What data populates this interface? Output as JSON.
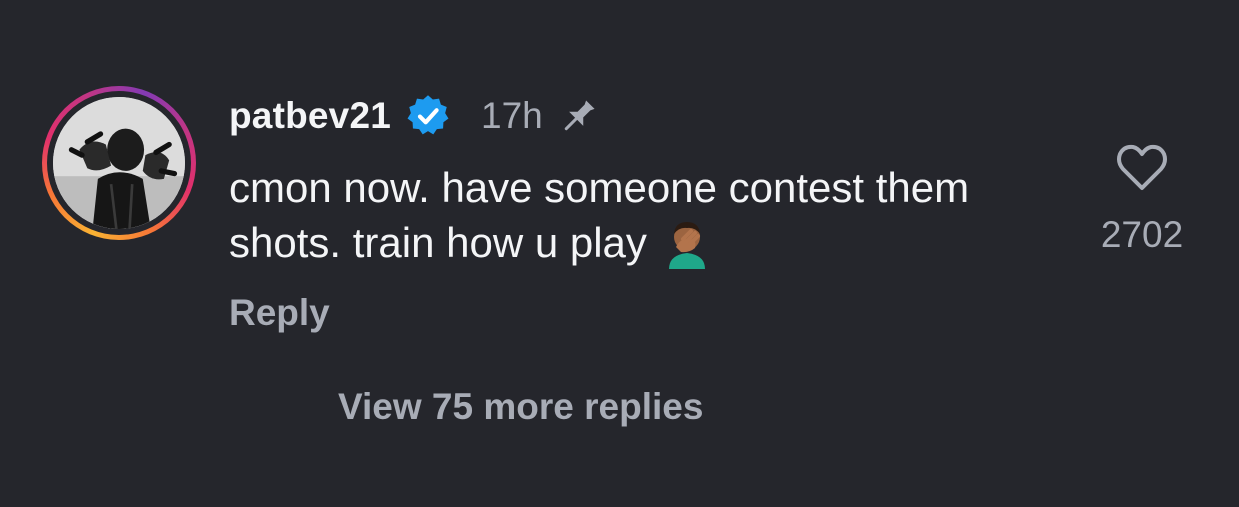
{
  "comment": {
    "username": "patbev21",
    "verified_icon": "verified-badge-icon",
    "timestamp": "17h",
    "pinned_icon": "pin-icon",
    "text": "cmon now. have someone contest them shots. train how u play",
    "emoji_icon": "facepalm-emoji-icon",
    "reply_label": "Reply",
    "like_icon": "heart-icon",
    "like_count": "2702",
    "view_replies_label": "View 75 more replies"
  },
  "colors": {
    "background": "#25262c",
    "primary_text": "#f4f5f7",
    "secondary_text": "#a8acb6",
    "verified_blue": "#1d9bf0"
  }
}
